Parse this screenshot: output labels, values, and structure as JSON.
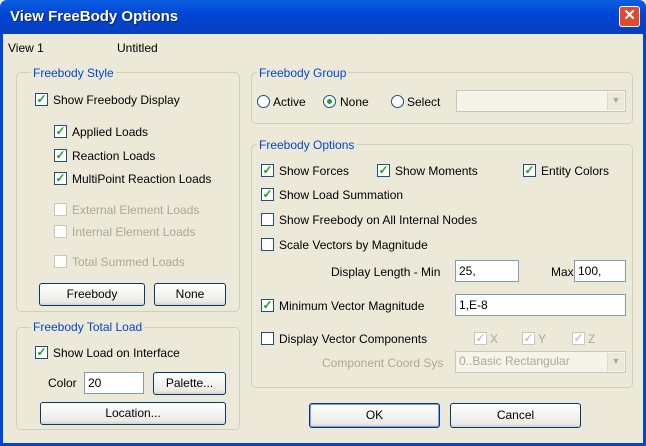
{
  "window": {
    "title": "View FreeBody Options",
    "close_icon": "close-icon"
  },
  "header": {
    "view_label": "View 1",
    "view_name": "Untitled"
  },
  "freebody_style": {
    "legend": "Freebody Style",
    "show_display": {
      "label": "Show Freebody Display",
      "checked": true
    },
    "applied_loads": {
      "label": "Applied Loads",
      "checked": true
    },
    "reaction_loads": {
      "label": "Reaction Loads",
      "checked": true
    },
    "multipoint_reaction": {
      "label": "MultiPoint Reaction Loads",
      "checked": true
    },
    "external_element": {
      "label": "External Element Loads",
      "checked": false,
      "disabled": true
    },
    "internal_element": {
      "label": "Internal Element Loads",
      "checked": false,
      "disabled": true
    },
    "total_summed": {
      "label": "Total Summed Loads",
      "checked": false,
      "disabled": true
    },
    "freebody_button": "Freebody",
    "none_button": "None"
  },
  "total_load": {
    "legend": "Freebody Total Load",
    "show_on_interface": {
      "label": "Show Load on Interface",
      "checked": true
    },
    "color_label": "Color",
    "color_value": "20",
    "palette_button": "Palette...",
    "location_button": "Location..."
  },
  "freebody_group": {
    "legend": "Freebody Group",
    "active_label": "Active",
    "none_label": "None",
    "select_label": "Select",
    "selected": "None",
    "select_value": ""
  },
  "freebody_options": {
    "legend": "Freebody Options",
    "show_forces": {
      "label": "Show Forces",
      "checked": true
    },
    "show_moments": {
      "label": "Show Moments",
      "checked": true
    },
    "entity_colors": {
      "label": "Entity Colors",
      "checked": true
    },
    "show_load_summation": {
      "label": "Show Load Summation",
      "checked": true
    },
    "show_all_internal": {
      "label": "Show Freebody on All Internal Nodes",
      "checked": false
    },
    "scale_vectors": {
      "label": "Scale Vectors by Magnitude",
      "checked": false
    },
    "display_length_min_label": "Display Length - Min",
    "display_length_min": "25,",
    "max_label": "Max",
    "max_value": "100,",
    "min_vector_magnitude": {
      "label": "Minimum Vector Magnitude",
      "checked": true,
      "value": "1,E-8"
    },
    "display_vector_components": {
      "label": "Display Vector Components",
      "checked": false
    },
    "x": {
      "label": "X",
      "checked": true
    },
    "y": {
      "label": "Y",
      "checked": true
    },
    "z": {
      "label": "Z",
      "checked": true
    },
    "coord_sys_label": "Component Coord Sys",
    "coord_sys_value": "0..Basic Rectangular"
  },
  "footer": {
    "ok_button": "OK",
    "cancel_button": "Cancel"
  },
  "colors": {
    "title_bar": "#0046d5",
    "dialog_bg": "#ece9d8",
    "legend_text": "#0046d5",
    "check_mark": "#21a121",
    "close_button": "#e0492c"
  }
}
